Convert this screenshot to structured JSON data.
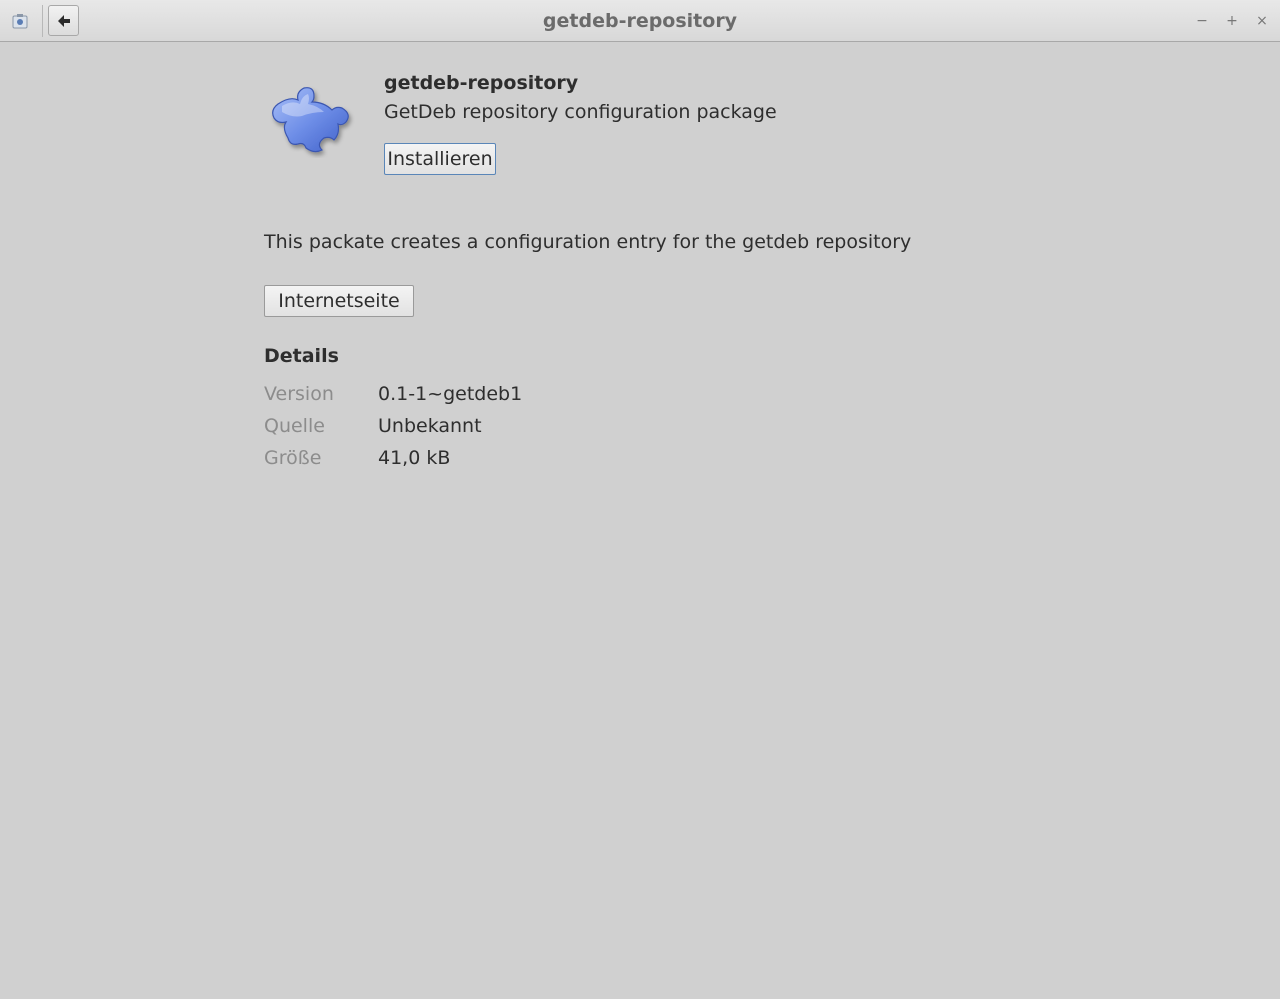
{
  "window": {
    "title": "getdeb-repository",
    "controls": {
      "minimize_icon": "−",
      "maximize_icon": "+",
      "close_icon": "×"
    }
  },
  "toolbar": {
    "app_icon": "package-installer-icon",
    "back_icon": "arrow-left-icon"
  },
  "package": {
    "icon": "puzzle-piece-icon",
    "name": "getdeb-repository",
    "summary": "GetDeb repository configuration package",
    "install_label": "Installieren",
    "description": "This packate creates a configuration entry for the getdeb repository",
    "website_label": "Internetseite"
  },
  "details": {
    "title": "Details",
    "rows": [
      {
        "key": "Version",
        "value": "0.1-1~getdeb1"
      },
      {
        "key": "Quelle",
        "value": "Unbekannt"
      },
      {
        "key": "Größe",
        "value": "41,0 kB"
      }
    ]
  },
  "colors": {
    "background": "#d0d0d0",
    "accent_focus": "#5a86b8",
    "puzzle_blue": "#6f8fe8"
  }
}
